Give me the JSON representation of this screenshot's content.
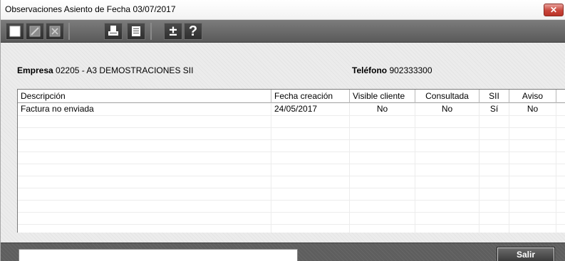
{
  "window": {
    "title": "Observaciones Asiento de Fecha 03/07/2017",
    "close_symbol": "✕"
  },
  "toolbar": {
    "buttons": [
      {
        "name": "new-icon"
      },
      {
        "name": "edit-icon"
      },
      {
        "name": "delete-icon"
      },
      {
        "name": "print-icon"
      },
      {
        "name": "list-icon"
      },
      {
        "name": "plus-minus-icon",
        "glyph": "±"
      },
      {
        "name": "help-icon",
        "glyph": "?"
      }
    ]
  },
  "info": {
    "empresa_label": "Empresa",
    "empresa_value": "02205 - A3 DEMOSTRACIONES SII",
    "telefono_label": "Teléfono",
    "telefono_value": "902333300"
  },
  "grid": {
    "columns": [
      "Descripción",
      "Fecha creación",
      "Visible cliente",
      "Consultada",
      "SII",
      "Aviso"
    ],
    "rows": [
      [
        "Factura no enviada",
        "24/05/2017",
        "No",
        "No",
        "Sí",
        "No"
      ]
    ]
  },
  "footer": {
    "salir_label": "Salir"
  },
  "colors": {
    "toolbar_bg": "#5a5a5a",
    "close_button": "#c9453a"
  }
}
